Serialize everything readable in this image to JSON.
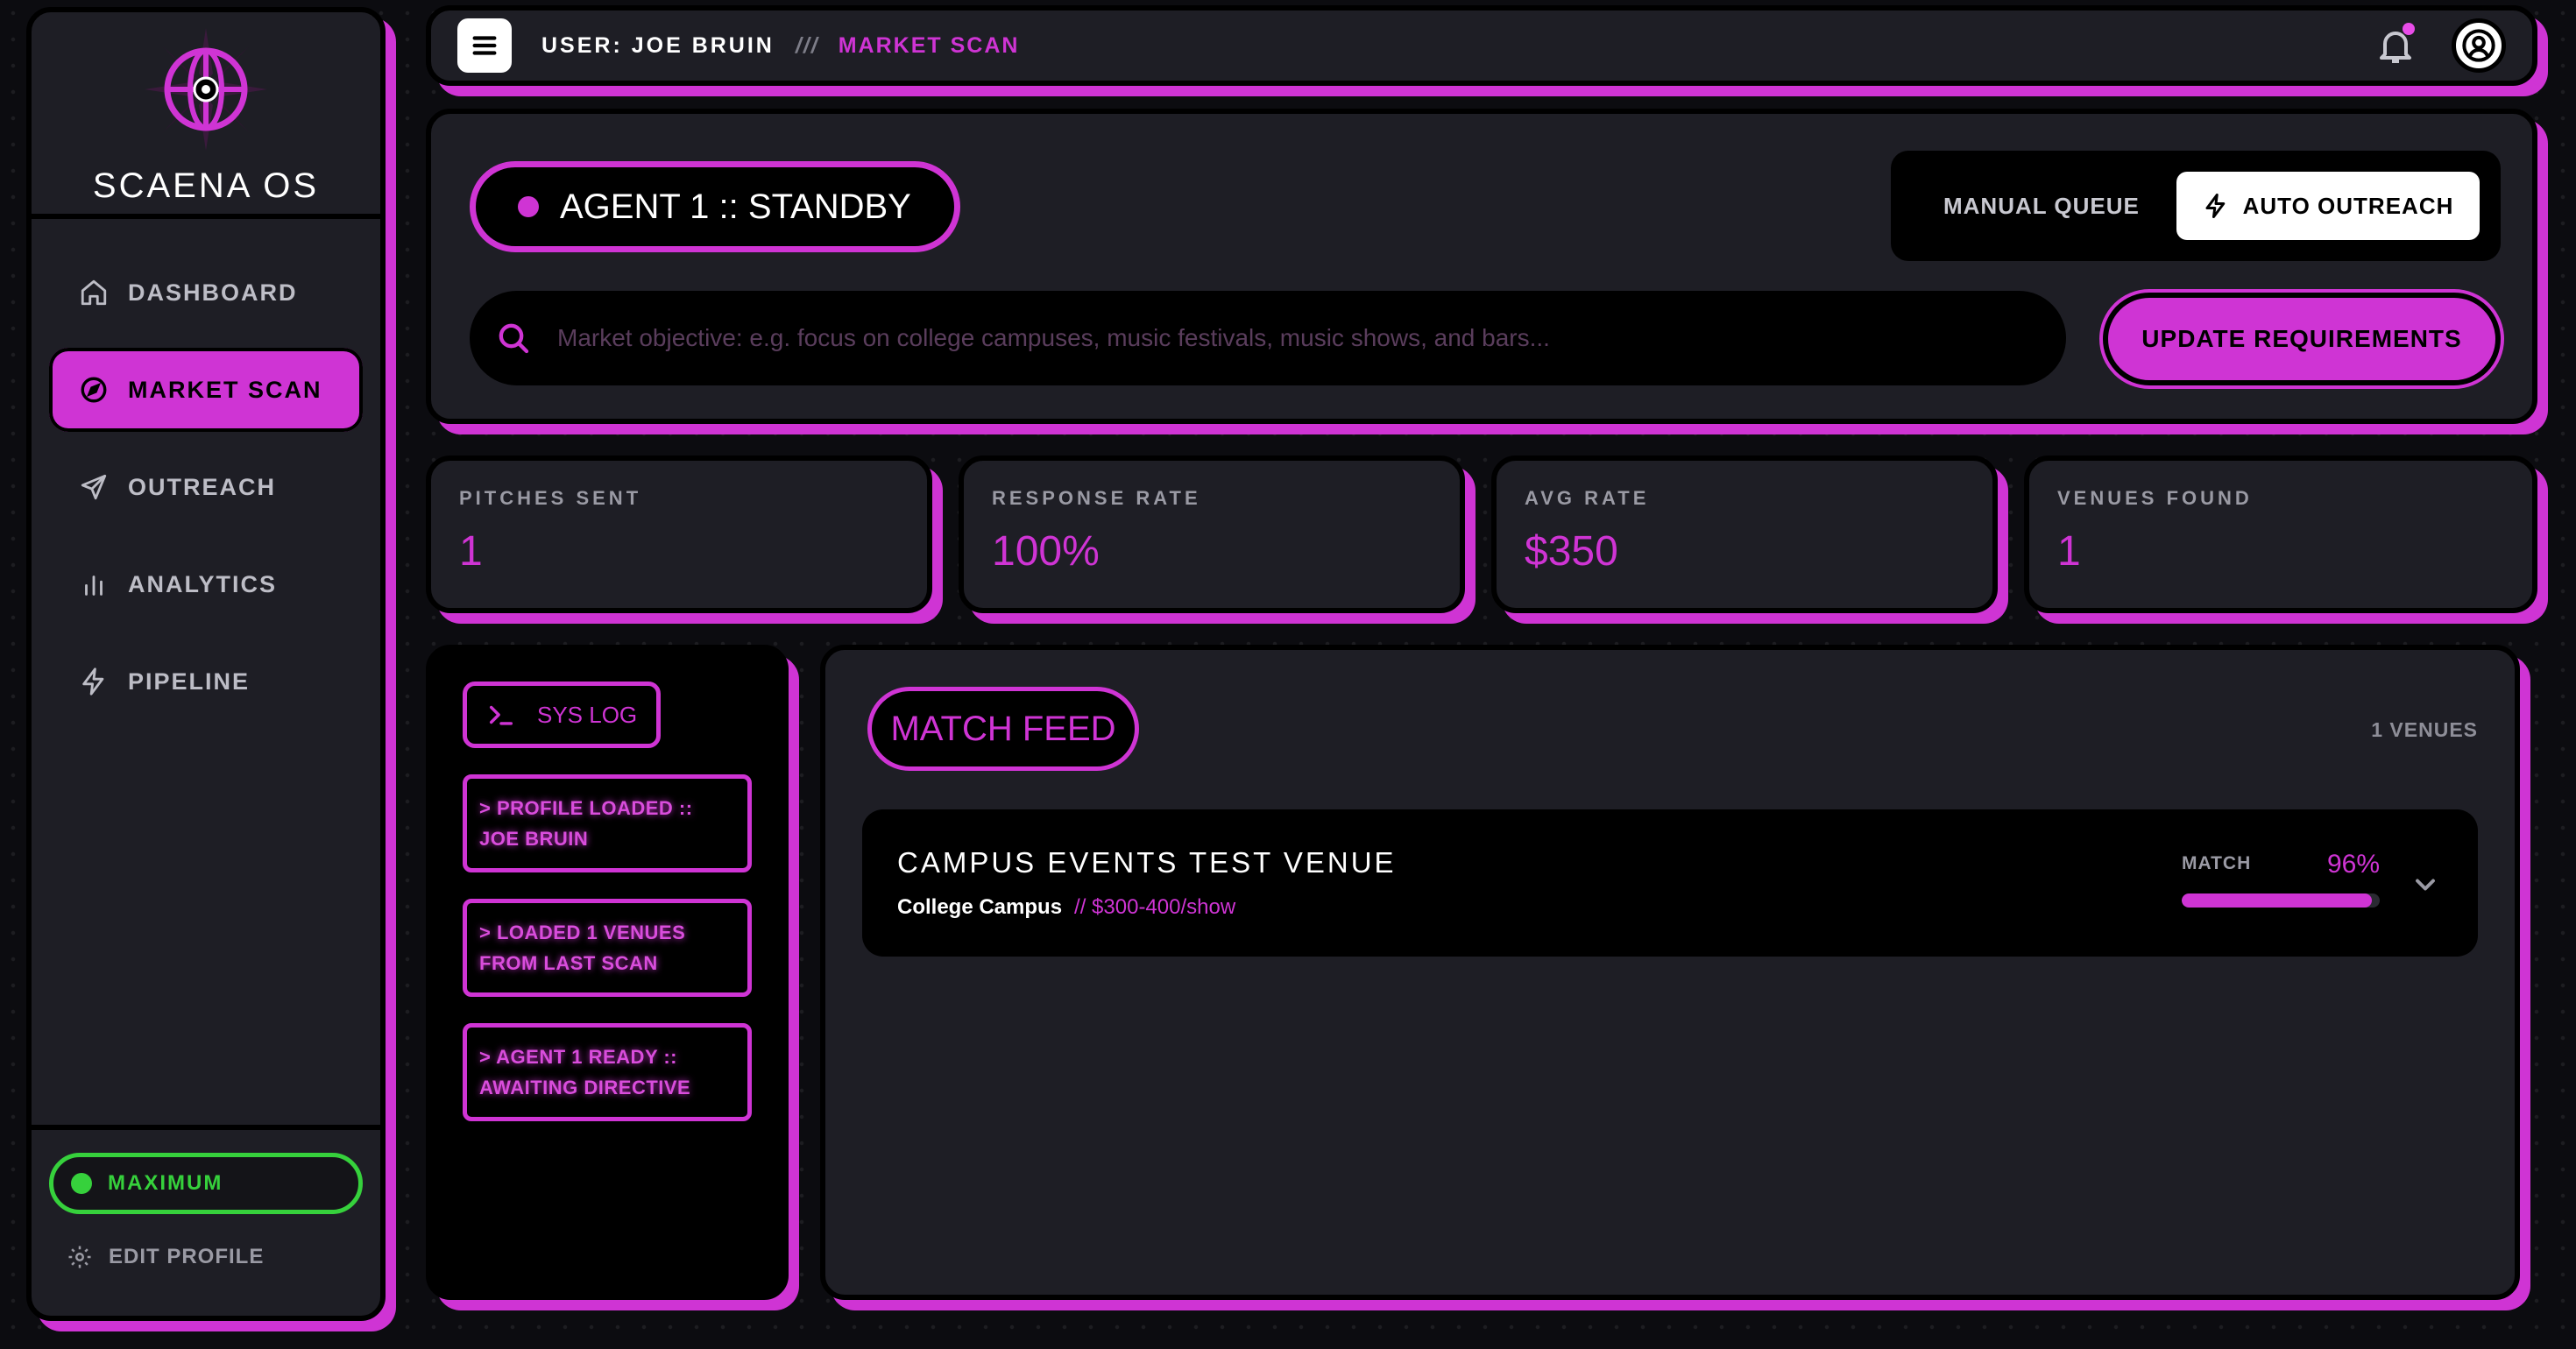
{
  "brand": {
    "name": "SCAENA OS",
    "logo_icon": "globe-icon"
  },
  "sidebar": {
    "items": [
      {
        "label": "DASHBOARD",
        "icon": "home-icon",
        "active": false
      },
      {
        "label": "MARKET SCAN",
        "icon": "compass-icon",
        "active": true
      },
      {
        "label": "OUTREACH",
        "icon": "send-icon",
        "active": false
      },
      {
        "label": "ANALYTICS",
        "icon": "bar-chart-icon",
        "active": false
      },
      {
        "label": "PIPELINE",
        "icon": "lightning-icon",
        "active": false
      }
    ],
    "tier": {
      "label": "MAXIMUM",
      "color": "#36d13c"
    },
    "edit_profile": "EDIT PROFILE"
  },
  "header": {
    "user_label": "USER: JOE BRUIN",
    "separator": "///",
    "breadcrumb": "MARKET SCAN"
  },
  "control": {
    "agent_status": "AGENT 1 :: STANDBY",
    "mode_manual": "MANUAL QUEUE",
    "mode_auto": "AUTO OUTREACH",
    "search_placeholder": "Market objective: e.g. focus on college campuses, music festivals, music shows, and bars...",
    "update_button": "UPDATE REQUIREMENTS"
  },
  "stats": [
    {
      "label": "PITCHES SENT",
      "value": "1"
    },
    {
      "label": "RESPONSE RATE",
      "value": "100%"
    },
    {
      "label": "AVG RATE",
      "value": "$350"
    },
    {
      "label": "VENUES FOUND",
      "value": "1"
    }
  ],
  "syslog": {
    "button": "SYS LOG",
    "entries": [
      "> PROFILE LOADED :: JOE BRUIN",
      "> LOADED 1 VENUES FROM LAST SCAN",
      "> AGENT 1 READY :: AWAITING DIRECTIVE"
    ]
  },
  "feed": {
    "title": "MATCH FEED",
    "count": "1 VENUES",
    "venues": [
      {
        "name": "CAMPUS EVENTS TEST VENUE",
        "type": "College Campus",
        "price": "// $300-400/show",
        "match_label": "MATCH",
        "match_value": "96%",
        "match_fraction": 0.96
      }
    ]
  },
  "colors": {
    "accent": "#cf34d4",
    "panel": "#1e1e25",
    "background": "#0c0c10",
    "tier_green": "#36d13c"
  }
}
